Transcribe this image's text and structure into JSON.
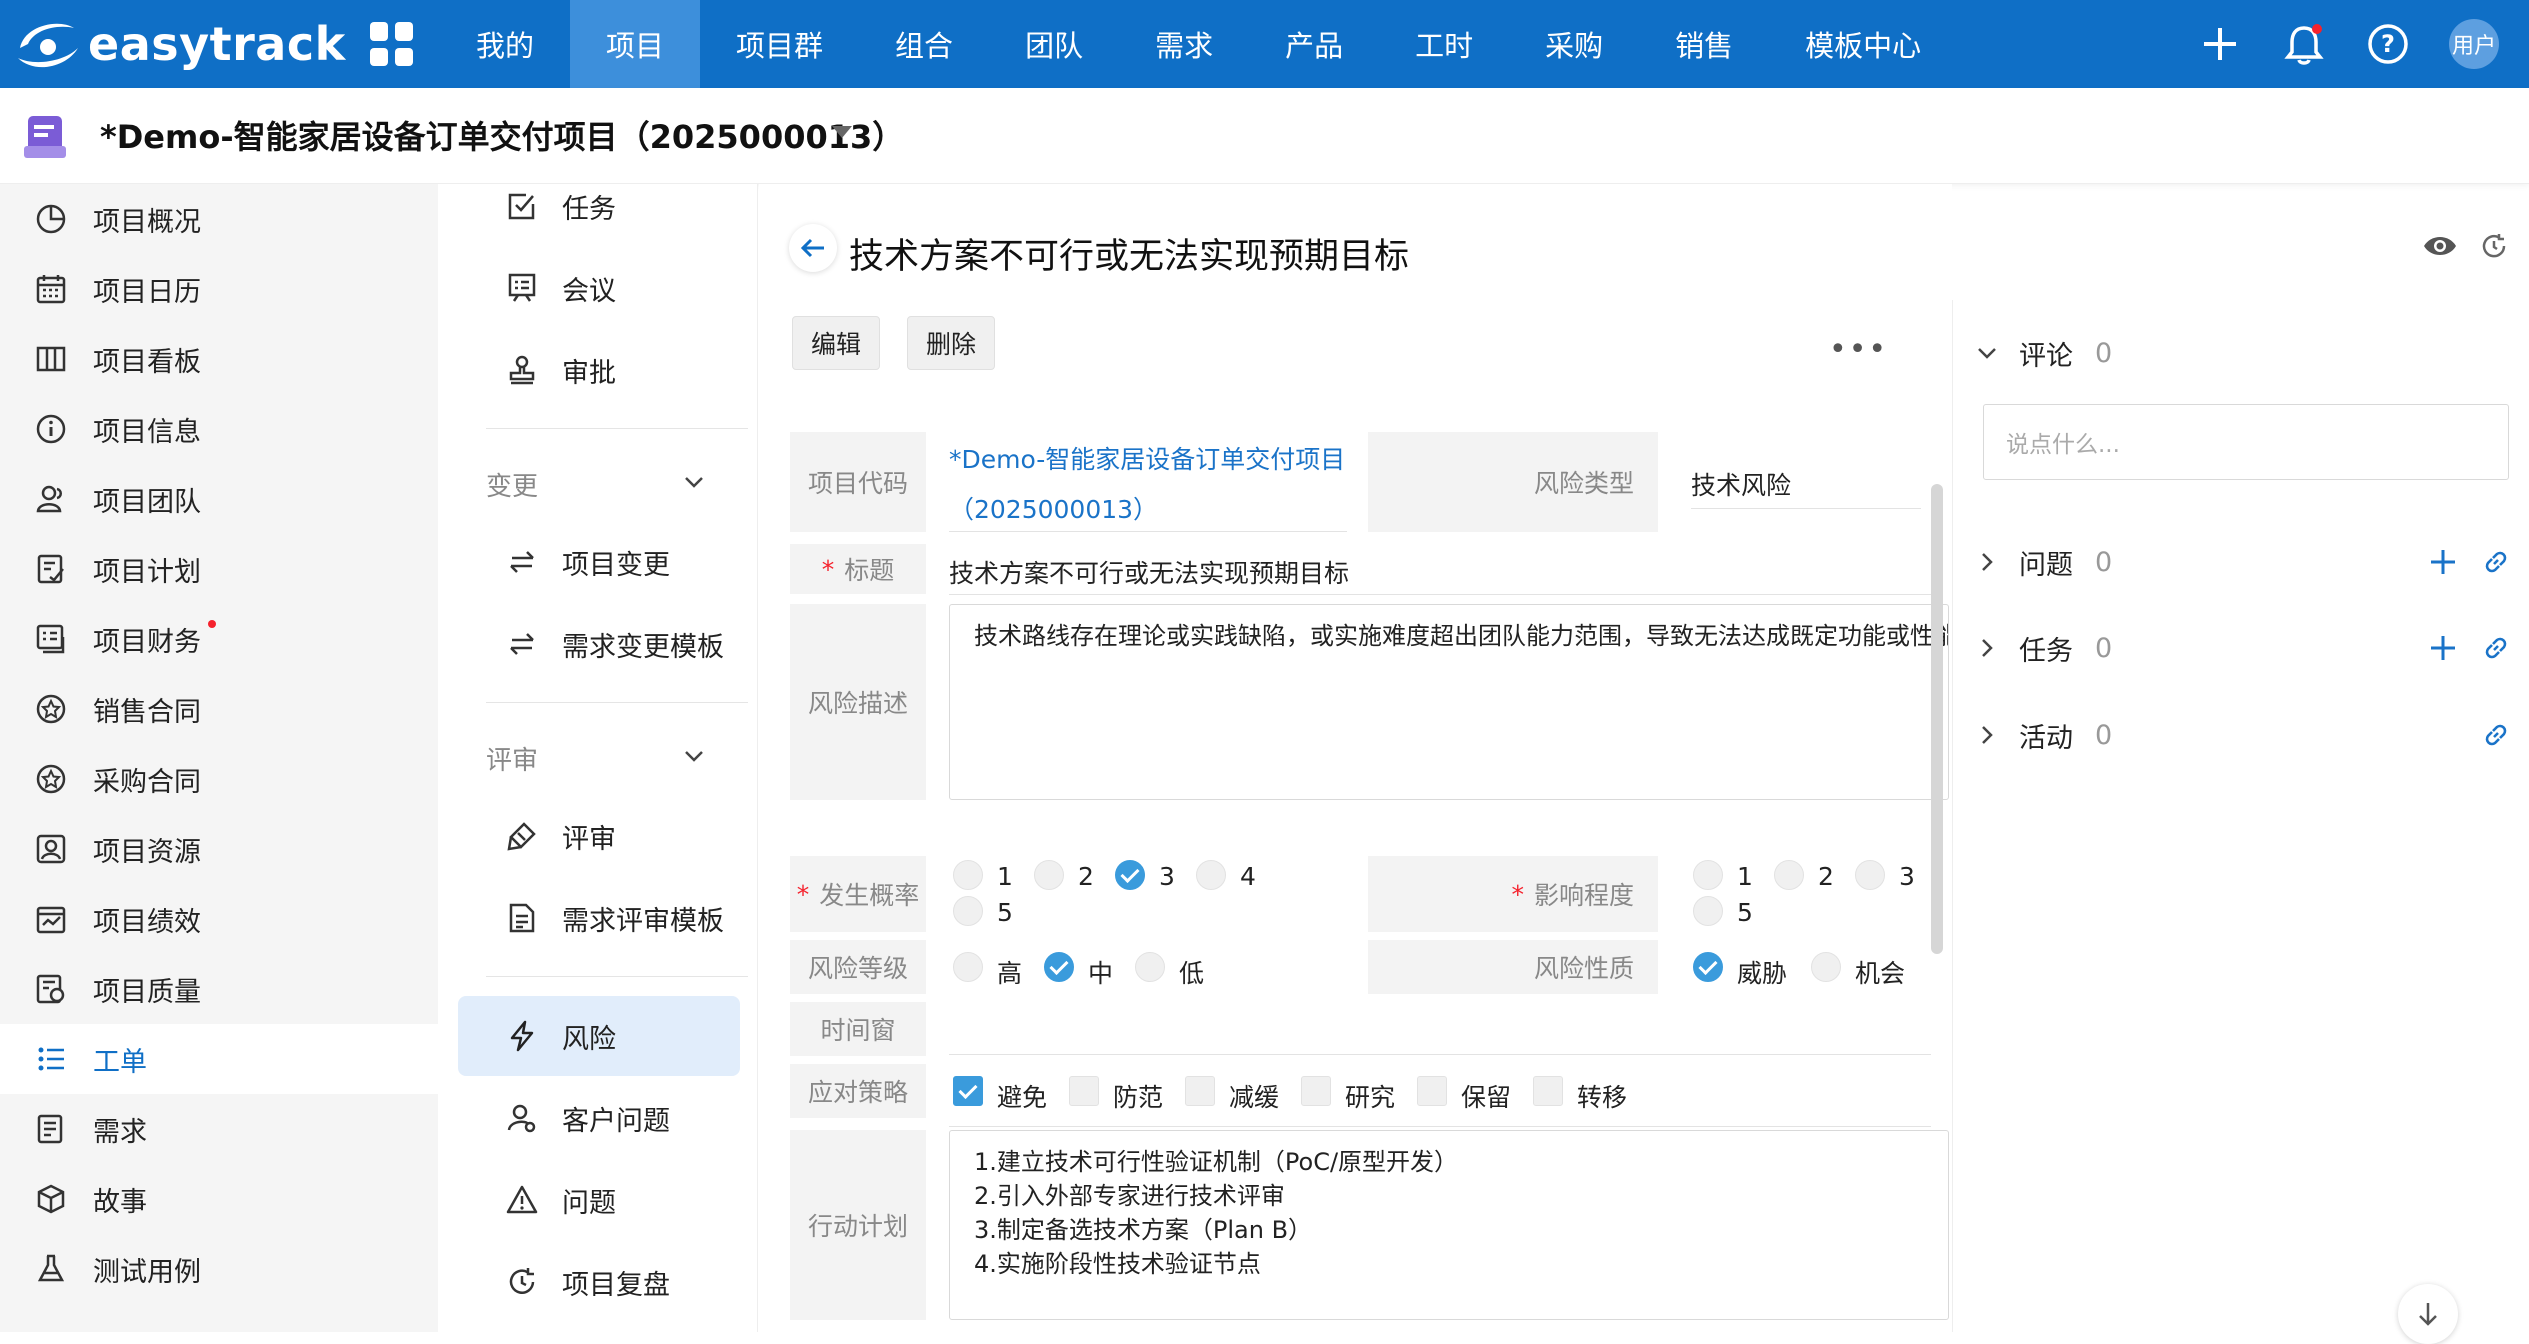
{
  "brand": {
    "name": "easytrack"
  },
  "topnav": {
    "items": [
      "我的",
      "项目",
      "项目群",
      "组合",
      "团队",
      "需求",
      "产品",
      "工时",
      "采购",
      "销售",
      "模板中心"
    ],
    "active_index": 1,
    "avatar_label": "用户",
    "colors": {
      "bar": "#0f6fc6",
      "active": "#3d8fdb"
    }
  },
  "project": {
    "title": "*Demo-智能家居设备订单交付项目（2025000013）"
  },
  "sidebar": {
    "items": [
      {
        "label": "项目概况",
        "icon": "pie-chart-icon"
      },
      {
        "label": "项目日历",
        "icon": "calendar-icon"
      },
      {
        "label": "项目看板",
        "icon": "kanban-icon"
      },
      {
        "label": "项目信息",
        "icon": "info-icon"
      },
      {
        "label": "项目团队",
        "icon": "team-icon"
      },
      {
        "label": "项目计划",
        "icon": "plan-icon"
      },
      {
        "label": "项目财务",
        "icon": "finance-icon"
      },
      {
        "label": "销售合同",
        "icon": "contract-icon"
      },
      {
        "label": "采购合同",
        "icon": "contract-icon"
      },
      {
        "label": "项目资源",
        "icon": "resource-icon"
      },
      {
        "label": "项目绩效",
        "icon": "performance-icon"
      },
      {
        "label": "项目质量",
        "icon": "quality-icon"
      },
      {
        "label": "工单",
        "icon": "list-icon"
      },
      {
        "label": "需求",
        "icon": "requirement-icon"
      },
      {
        "label": "故事",
        "icon": "cube-icon"
      },
      {
        "label": "测试用例",
        "icon": "flask-icon"
      }
    ],
    "active_index": 12
  },
  "subnav": {
    "items_top": [
      {
        "label": "任务",
        "icon": "checkbox-icon"
      },
      {
        "label": "会议",
        "icon": "meeting-icon"
      },
      {
        "label": "审批",
        "icon": "stamp-icon"
      }
    ],
    "section_change": "变更",
    "items_change": [
      {
        "label": "项目变更",
        "icon": "swap-icon"
      },
      {
        "label": "需求变更模板",
        "icon": "swap-icon"
      }
    ],
    "section_review": "评审",
    "items_review": [
      {
        "label": "评审",
        "icon": "review-icon"
      },
      {
        "label": "需求评审模板",
        "icon": "document-icon"
      }
    ],
    "items_bottom": [
      {
        "label": "风险",
        "icon": "lightning-icon",
        "active": true
      },
      {
        "label": "客户问题",
        "icon": "customer-icon"
      },
      {
        "label": "问题",
        "icon": "warning-icon"
      },
      {
        "label": "项目复盘",
        "icon": "replay-icon"
      }
    ]
  },
  "detail": {
    "title": "技术方案不可行或无法实现预期目标",
    "edit_label": "编辑",
    "delete_label": "删除",
    "more_label": "•••",
    "fields": {
      "project_code_label": "项目代码",
      "project_code_line1": "*Demo-智能家居设备订单交付项目",
      "project_code_line2": "（2025000013）",
      "risk_type_label": "风险类型",
      "risk_type_value": "技术风险",
      "title_label": "标题",
      "title_value": "技术方案不可行或无法实现预期目标",
      "desc_label": "风险描述",
      "desc_value": "技术路线存在理论或实践缺陷，或实施难度超出团队能力范围，导致无法达成既定功能或性能指标",
      "probability_label": "发生概率",
      "probability_options": [
        "1",
        "2",
        "3",
        "4",
        "5"
      ],
      "probability_selected": "3",
      "impact_label": "影响程度",
      "impact_options": [
        "1",
        "2",
        "3",
        "5"
      ],
      "impact_selected": "",
      "level_label": "风险等级",
      "level_options": [
        "高",
        "中",
        "低"
      ],
      "level_selected": "中",
      "nature_label": "风险性质",
      "nature_options": [
        "威胁",
        "机会"
      ],
      "nature_selected": "威胁",
      "window_label": "时间窗",
      "strategy_label": "应对策略",
      "strategy_options": [
        "避免",
        "防范",
        "减缓",
        "研究",
        "保留",
        "转移"
      ],
      "strategy_checked": [
        "避免"
      ],
      "action_label": "行动计划",
      "action_lines": [
        "1.建立技术可行性验证机制（PoC/原型开发）",
        "2.引入外部专家进行技术评审",
        "3.制定备选技术方案（Plan B）",
        "4.实施阶段性技术验证节点"
      ]
    }
  },
  "right_panel": {
    "comments_label": "评论",
    "comments_count": "0",
    "comment_placeholder": "说点什么...",
    "issues_label": "问题",
    "issues_count": "0",
    "tasks_label": "任务",
    "tasks_count": "0",
    "activity_label": "活动",
    "activity_count": "0"
  },
  "accent_color": "#3a9bdc"
}
